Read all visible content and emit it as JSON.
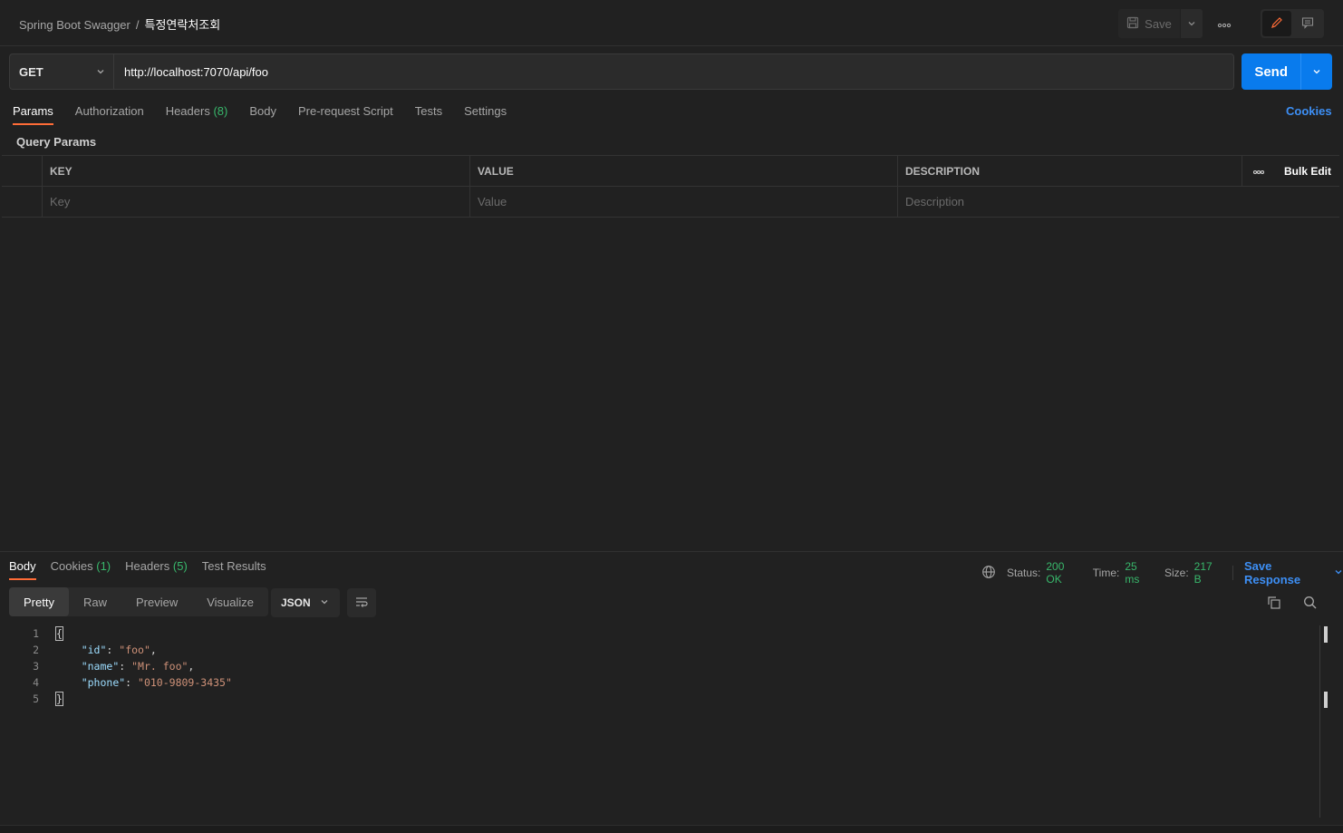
{
  "header": {
    "collection": "Spring Boot Swagger",
    "separator": "/",
    "request_name": "특정연락처조회",
    "save_label": "Save"
  },
  "request": {
    "method": "GET",
    "url": "http://localhost:7070/api/foo",
    "send_label": "Send"
  },
  "request_tabs": [
    {
      "label": "Params",
      "count": ""
    },
    {
      "label": "Authorization",
      "count": ""
    },
    {
      "label": "Headers",
      "count": "(8)"
    },
    {
      "label": "Body",
      "count": ""
    },
    {
      "label": "Pre-request Script",
      "count": ""
    },
    {
      "label": "Tests",
      "count": ""
    },
    {
      "label": "Settings",
      "count": ""
    }
  ],
  "cookies_link": "Cookies",
  "params": {
    "title": "Query Params",
    "headers": {
      "key": "KEY",
      "value": "VALUE",
      "description": "DESCRIPTION",
      "bulk_edit": "Bulk Edit"
    },
    "placeholders": {
      "key": "Key",
      "value": "Value",
      "description": "Description"
    }
  },
  "response": {
    "tabs": [
      {
        "label": "Body",
        "count": ""
      },
      {
        "label": "Cookies",
        "count": "(1)"
      },
      {
        "label": "Headers",
        "count": "(5)"
      },
      {
        "label": "Test Results",
        "count": ""
      }
    ],
    "status_label": "Status:",
    "status_value": "200 OK",
    "time_label": "Time:",
    "time_value": "25 ms",
    "size_label": "Size:",
    "size_value": "217 B",
    "save_response": "Save Response",
    "format_buttons": [
      "Pretty",
      "Raw",
      "Preview",
      "Visualize"
    ],
    "language": "JSON",
    "lines": [
      {
        "num": "1",
        "indent": "",
        "key": "",
        "value": "",
        "text": "{"
      },
      {
        "num": "2",
        "indent": "    ",
        "key": "\"id\"",
        "value": "\"foo\"",
        "text": ","
      },
      {
        "num": "3",
        "indent": "    ",
        "key": "\"name\"",
        "value": "\"Mr. foo\"",
        "text": ","
      },
      {
        "num": "4",
        "indent": "    ",
        "key": "\"phone\"",
        "value": "\"010-9809-3435\"",
        "text": ""
      },
      {
        "num": "5",
        "indent": "",
        "key": "",
        "value": "",
        "text": "}"
      }
    ]
  }
}
